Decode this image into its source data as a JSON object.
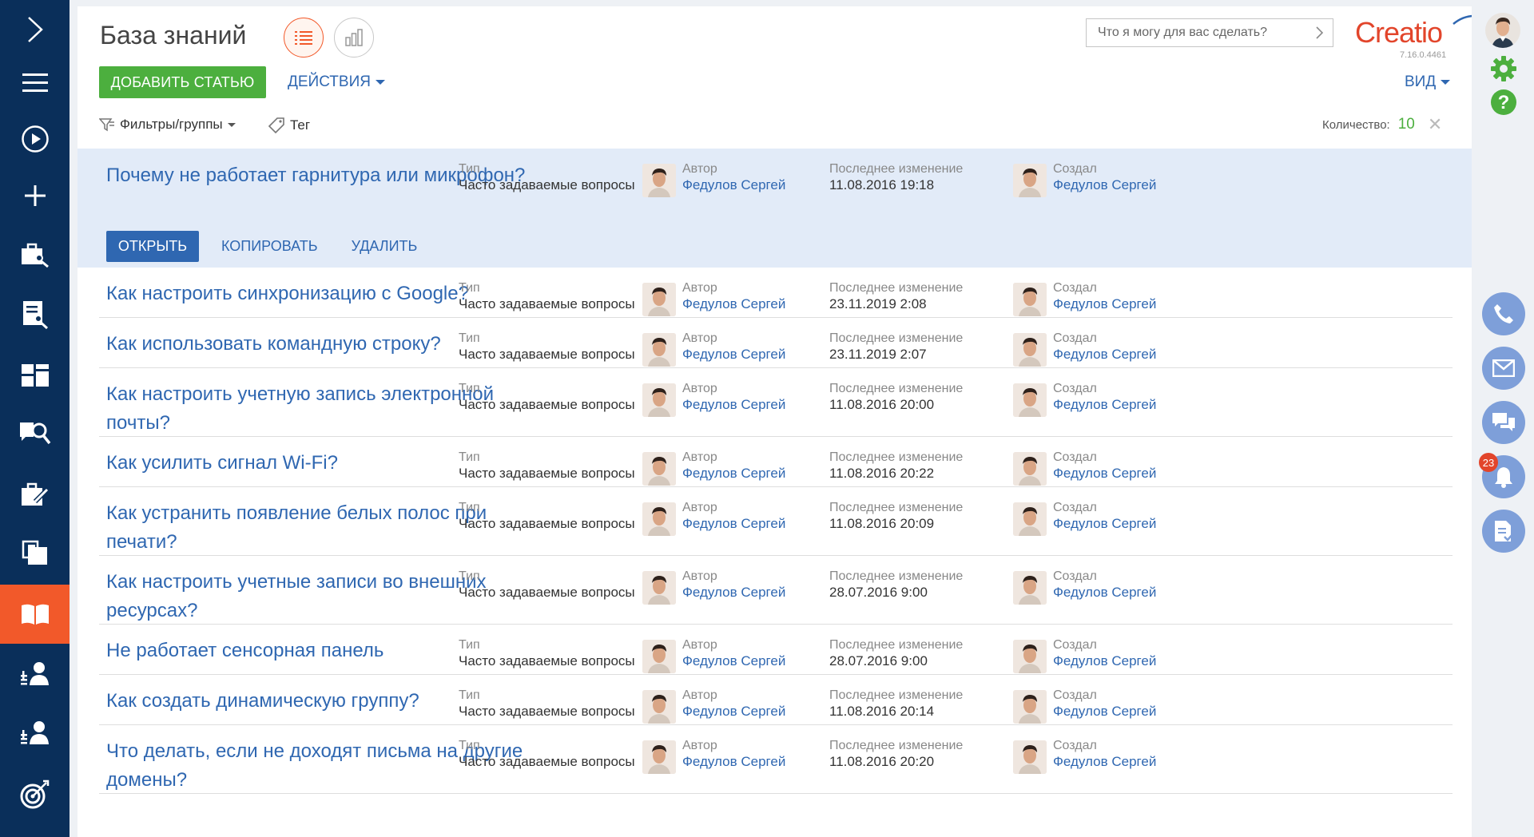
{
  "page_title": "База знаний",
  "toolbar": {
    "add_label": "ДОБАВИТЬ СТАТЬЮ",
    "actions_label": "ДЕЙСТВИЯ",
    "filters_label": "Фильтры/группы",
    "tag_label": "Тег",
    "view_label": "ВИД",
    "count_label": "Количество:",
    "count_value": "10"
  },
  "search": {
    "placeholder": "Что я могу для вас сделать?"
  },
  "brand": {
    "logo": "Creatio",
    "version": "7.16.0.4461",
    "accent": "#f2592a",
    "primary": "#2f67b1",
    "success": "#4caf3e"
  },
  "row_actions": {
    "open": "ОТКРЫТЬ",
    "copy": "КОПИРОВАТЬ",
    "delete": "УДАЛИТЬ"
  },
  "columns": {
    "type": "Тип",
    "author": "Автор",
    "modified": "Последнее изменение",
    "created_by": "Создал"
  },
  "articles": [
    {
      "title": "Почему не работает гарнитура или микрофон?",
      "type": "Часто задаваемые вопросы",
      "author": "Федулов Сергей",
      "modified": "11.08.2016 19:18",
      "created_by": "Федулов Сергей"
    },
    {
      "title": "Как настроить синхронизацию с Google?",
      "type": "Часто задаваемые вопросы",
      "author": "Федулов Сергей",
      "modified": "23.11.2019 2:08",
      "created_by": "Федулов Сергей"
    },
    {
      "title": "Как использовать командную строку?",
      "type": "Часто задаваемые вопросы",
      "author": "Федулов Сергей",
      "modified": "23.11.2019 2:07",
      "created_by": "Федулов Сергей"
    },
    {
      "title": "Как настроить учетную запись электронной почты?",
      "type": "Часто задаваемые вопросы",
      "author": "Федулов Сергей",
      "modified": "11.08.2016 20:00",
      "created_by": "Федулов Сергей"
    },
    {
      "title": "Как усилить сигнал Wi-Fi?",
      "type": "Часто задаваемые вопросы",
      "author": "Федулов Сергей",
      "modified": "11.08.2016 20:22",
      "created_by": "Федулов Сергей"
    },
    {
      "title": "Как устранить появление белых полос при печати?",
      "type": "Часто задаваемые вопросы",
      "author": "Федулов Сергей",
      "modified": "11.08.2016 20:09",
      "created_by": "Федулов Сергей"
    },
    {
      "title": "Как настроить учетные записи во внешних ресурсах?",
      "type": "Часто задаваемые вопросы",
      "author": "Федулов Сергей",
      "modified": "28.07.2016 9:00",
      "created_by": "Федулов Сергей"
    },
    {
      "title": "Не работает сенсорная панель",
      "type": "Часто задаваемые вопросы",
      "author": "Федулов Сергей",
      "modified": "28.07.2016 9:00",
      "created_by": "Федулов Сергей"
    },
    {
      "title": "Как создать динамическую группу?",
      "type": "Часто задаваемые вопросы",
      "author": "Федулов Сергей",
      "modified": "11.08.2016 20:14",
      "created_by": "Федулов Сергей"
    },
    {
      "title": "Что делать, если не доходят письма на другие домены?",
      "type": "Часто задаваемые вопросы",
      "author": "Федулов Сергей",
      "modified": "11.08.2016 20:20",
      "created_by": "Федулов Сергей"
    }
  ],
  "left_nav": [
    {
      "icon": "chevron-right-icon"
    },
    {
      "icon": "menu-icon"
    },
    {
      "icon": "play-icon"
    },
    {
      "icon": "plus-icon"
    },
    {
      "icon": "case-tools-icon"
    },
    {
      "icon": "document-tools-icon"
    },
    {
      "icon": "dashboard-icon"
    },
    {
      "icon": "knowledge-search-icon"
    },
    {
      "icon": "case-edit-icon"
    },
    {
      "icon": "documents-icon"
    },
    {
      "icon": "book-icon",
      "active": true
    },
    {
      "icon": "user-list-icon"
    },
    {
      "icon": "user-list-2-icon"
    },
    {
      "icon": "target-icon"
    }
  ],
  "right_bar": {
    "notifications_count": "23"
  }
}
